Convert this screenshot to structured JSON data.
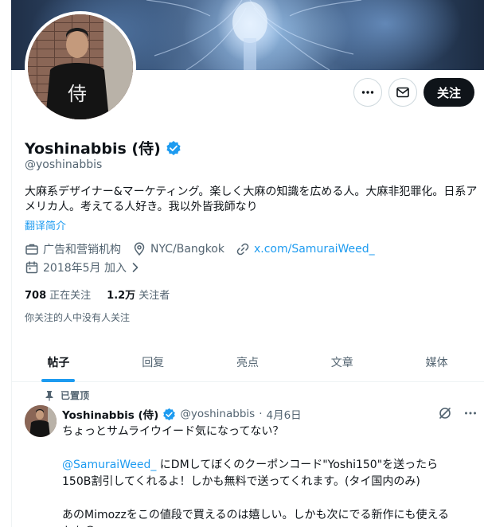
{
  "profile": {
    "name": "Yoshinabbis (侍)",
    "handle": "@yoshinabbis",
    "bio": "大麻系デザイナー&マーケティング。楽しく大麻の知識を広める人。大麻非犯罪化。日系アメリカ人。考えてる人好き。我以外皆我師なり",
    "translate_label": "翻译简介",
    "category": "广告和营销机构",
    "location": "NYC/Bangkok",
    "website": "x.com/SamuraiWeed_",
    "joined": "2018年5月 加入",
    "following_count": "708",
    "following_label": "正在关注",
    "followers_count": "1.2万",
    "followers_label": "关注者",
    "followers_you_know": "你关注的人中没有人关注",
    "avatar_shirt_text": "侍"
  },
  "actions": {
    "follow_label": "关注"
  },
  "tabs": [
    {
      "label": "帖子"
    },
    {
      "label": "回复"
    },
    {
      "label": "亮点"
    },
    {
      "label": "文章"
    },
    {
      "label": "媒体"
    }
  ],
  "post": {
    "pinned_label": "已置顶",
    "name": "Yoshinabbis (侍)",
    "handle": "@yoshinabbis",
    "separator": "·",
    "date": "4月6日",
    "line1": "ちょっとサムライウイード気になってない？",
    "mention": "@SamuraiWeed_",
    "line2_rest": " にDMしてぼくのクーポンコード\"Yoshi150\"を送ったら",
    "line3": "150B割引してくれるよ！しかも無料で送ってくれます。(タイ国内のみ)",
    "line4": "あのMimozzをこの値段で買えるのは嬉しい。しかも次にでる新作にも使える",
    "line5": "かも",
    "emoji": "😳"
  },
  "colors": {
    "accent": "#1d9bf0",
    "text": "#0f1419",
    "muted": "#536471",
    "border": "#eff3f4",
    "verified": "#1d9bf0"
  },
  "icons": [
    "more-icon",
    "message-icon",
    "verified-badge-icon",
    "briefcase-icon",
    "location-icon",
    "link-icon",
    "calendar-icon",
    "chevron-right-icon",
    "pin-icon",
    "grok-icon"
  ]
}
